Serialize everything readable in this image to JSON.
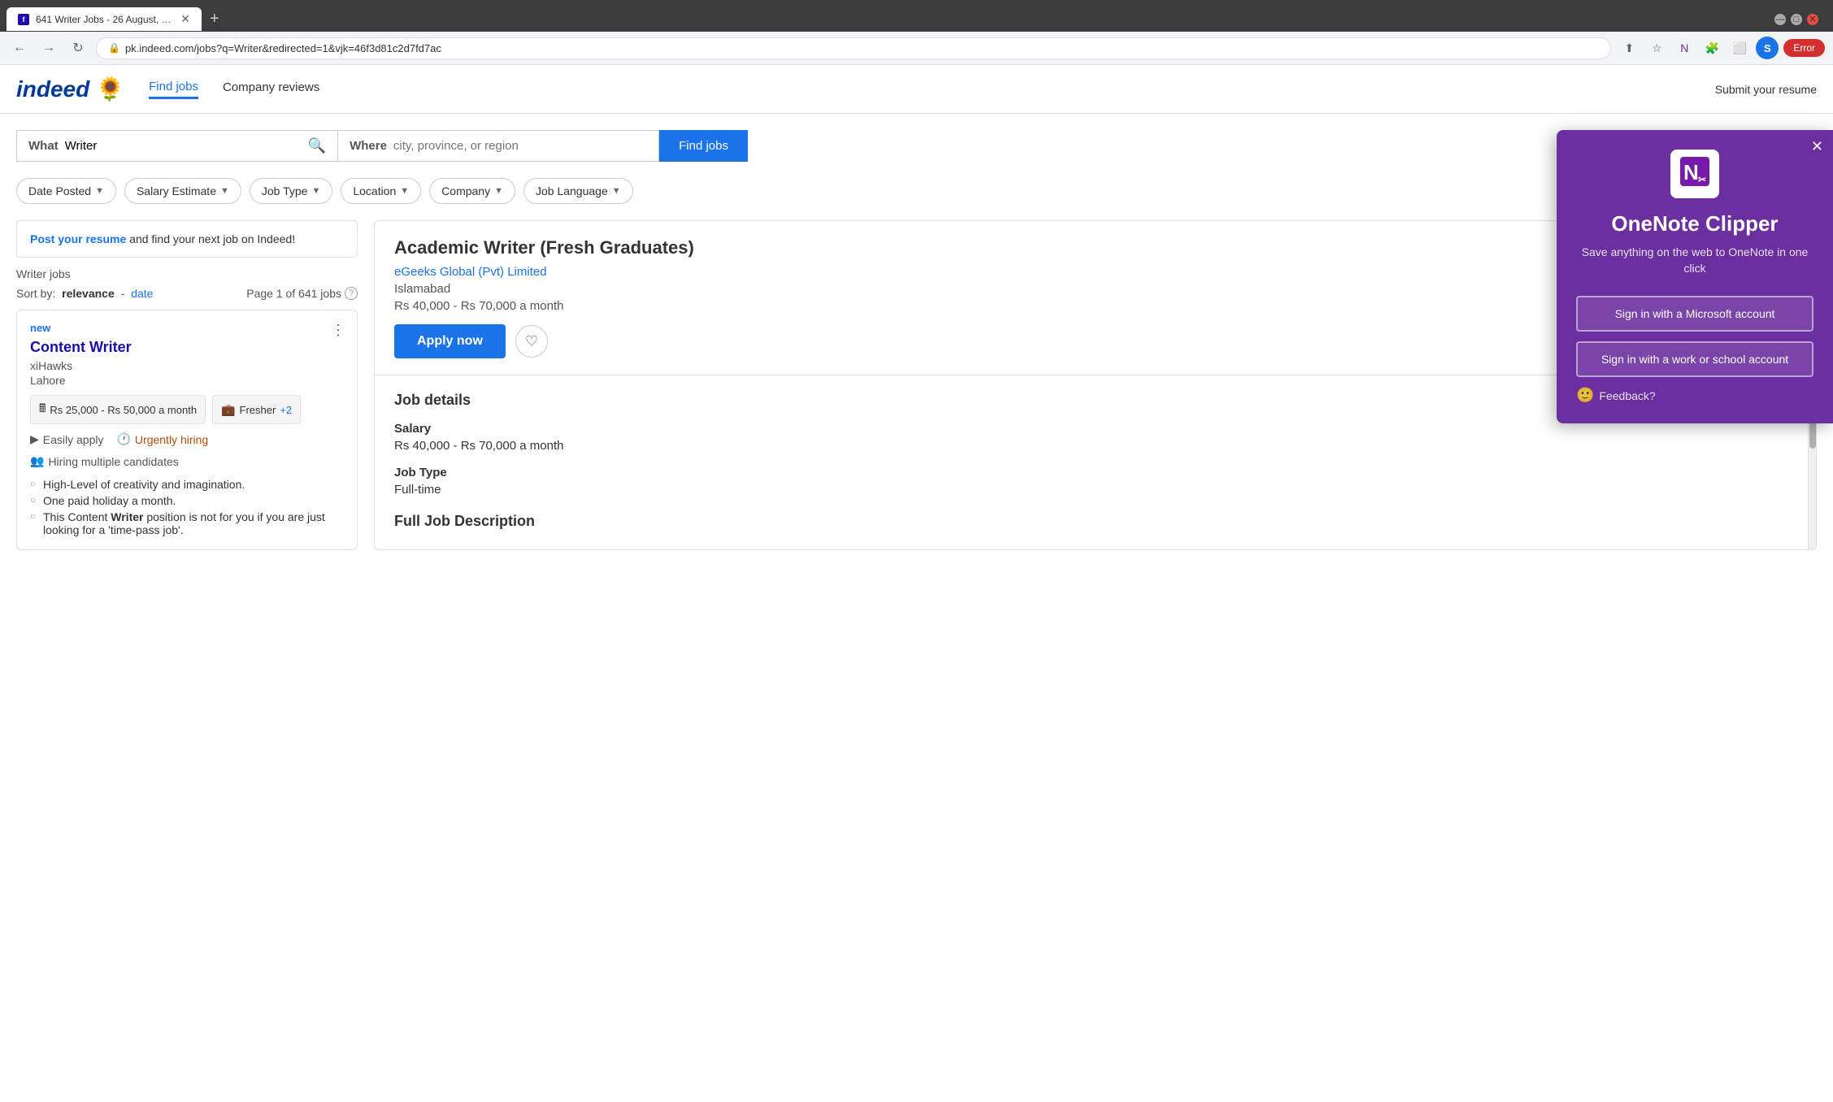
{
  "browser": {
    "tab_title": "641 Writer Jobs - 26 August, 202...",
    "tab_favicon": "f",
    "url": "pk.indeed.com/jobs?q=Writer&redirected=1&vjk=46f3d81c2d7fd7ac",
    "new_tab_label": "+",
    "nav_back": "←",
    "nav_forward": "→",
    "nav_refresh": "↻",
    "profile_initial": "S",
    "error_label": "Error"
  },
  "header": {
    "logo_text": "indeed",
    "find_jobs_label": "Find jobs",
    "company_reviews_label": "Company reviews",
    "submit_label": "Submit your resume"
  },
  "search": {
    "what_label": "What",
    "what_value": "Writer",
    "where_label": "Where",
    "where_placeholder": "city, province, or region",
    "find_btn_label": "Find jobs"
  },
  "filters": {
    "date_posted": "Date Posted",
    "salary_estimate": "Salary Estimate",
    "job_type": "Job Type",
    "location": "Location",
    "company": "Company",
    "job_language": "Job Language"
  },
  "left_panel": {
    "post_resume_link": "Post your resume",
    "post_resume_text": "and find your next job on Indeed!",
    "jobs_label": "Writer jobs",
    "sort_by_label": "Sort by:",
    "sort_relevance": "relevance",
    "sort_separator": "-",
    "sort_date": "date",
    "page_info": "Page 1 of 641 jobs",
    "job_card": {
      "new_badge": "new",
      "title": "Content Writer",
      "company": "xiHawks",
      "location": "Lahore",
      "salary_tag": "Rs 25,000 - Rs 50,000 a month",
      "experience_tag": "Fresher",
      "experience_count": "+2",
      "easily_apply": "Easily apply",
      "urgently_hiring": "Urgently hiring",
      "hiring_multiple": "Hiring multiple candidates",
      "bullet1": "High-Level of creativity and imagination.",
      "bullet2": "One paid holiday a month.",
      "bullet3_pre": "This Content ",
      "bullet3_bold": "Writer",
      "bullet3_post": " position is not for you if you are just looking for a 'time-pass job'."
    }
  },
  "right_panel": {
    "job_title": "Academic Writer (Fresh Graduates)",
    "company": "eGeeks Global (Pvt) Limited",
    "location": "Islamabad",
    "salary": "Rs 40,000 - Rs 70,000 a month",
    "apply_btn": "Apply now",
    "job_details_title": "Job details",
    "salary_label": "Salary",
    "salary_value": "Rs 40,000 - Rs 70,000 a month",
    "job_type_label": "Job Type",
    "job_type_value": "Full-time",
    "full_desc_title": "Full Job Description"
  },
  "onenote": {
    "title": "OneNote Clipper",
    "subtitle": "Save anything on the web to OneNote in one click",
    "btn1": "Sign in with a Microsoft account",
    "btn2": "Sign in with a work or school account",
    "feedback": "Feedback?"
  }
}
